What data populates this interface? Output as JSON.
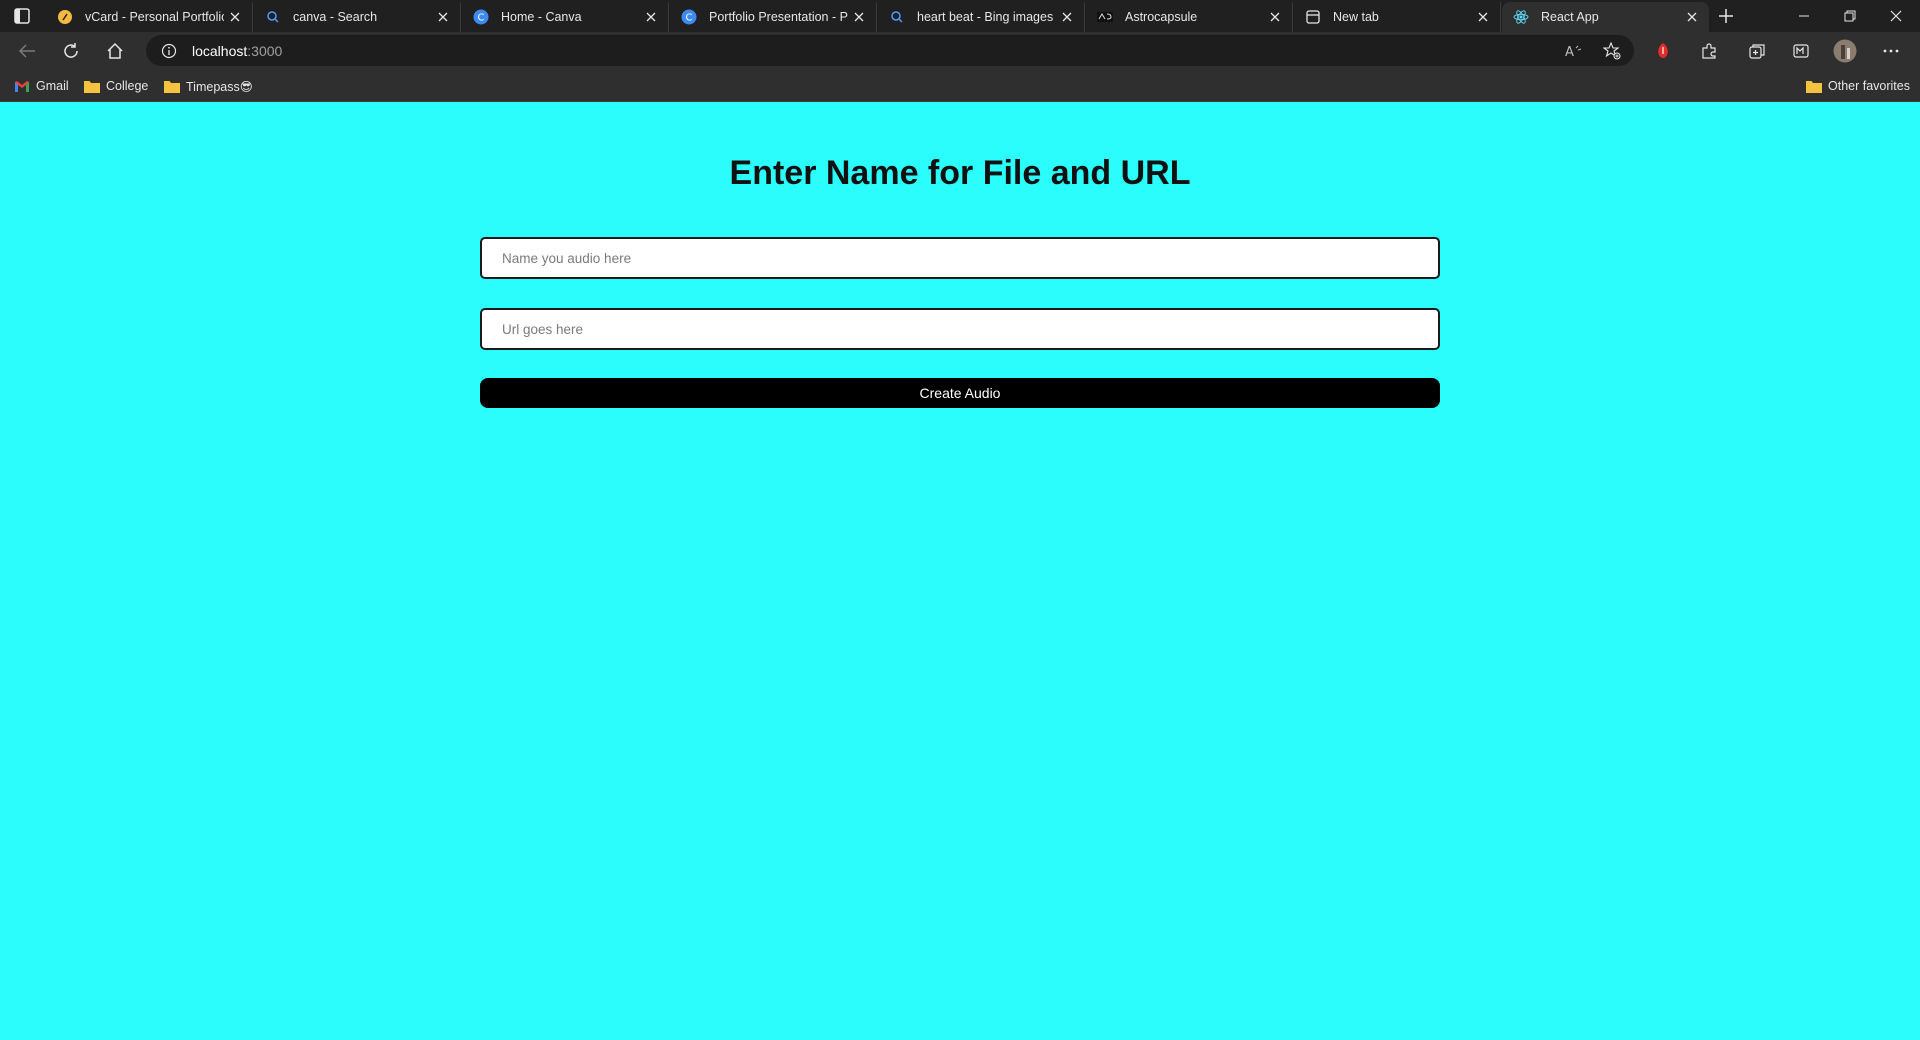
{
  "browser": {
    "tabs": [
      {
        "title": "vCard - Personal Portfolio",
        "icon": "vcard-favicon"
      },
      {
        "title": "canva - Search",
        "icon": "search-favicon"
      },
      {
        "title": "Home - Canva",
        "icon": "canva-favicon"
      },
      {
        "title": "Portfolio Presentation - Pre",
        "icon": "canva-favicon"
      },
      {
        "title": "heart beat - Bing images",
        "icon": "search-favicon"
      },
      {
        "title": "Astrocapsule",
        "icon": "astrocapsule-favicon"
      },
      {
        "title": "New tab",
        "icon": "newtab-favicon"
      },
      {
        "title": "React App",
        "icon": "react-favicon",
        "active": true
      }
    ],
    "address": {
      "host": "localhost",
      "port": ":3000"
    },
    "bookmarks": [
      {
        "label": "Gmail",
        "icon": "gmail-icon"
      },
      {
        "label": "College",
        "icon": "folder-icon"
      },
      {
        "label": "Timepass😎",
        "icon": "folder-icon"
      }
    ],
    "other_favorites": "Other favorites"
  },
  "page": {
    "title": "Enter Name for File and URL",
    "name_placeholder": "Name you audio here",
    "url_placeholder": "Url goes here",
    "button_label": "Create Audio",
    "background": "#2bfdfd"
  }
}
